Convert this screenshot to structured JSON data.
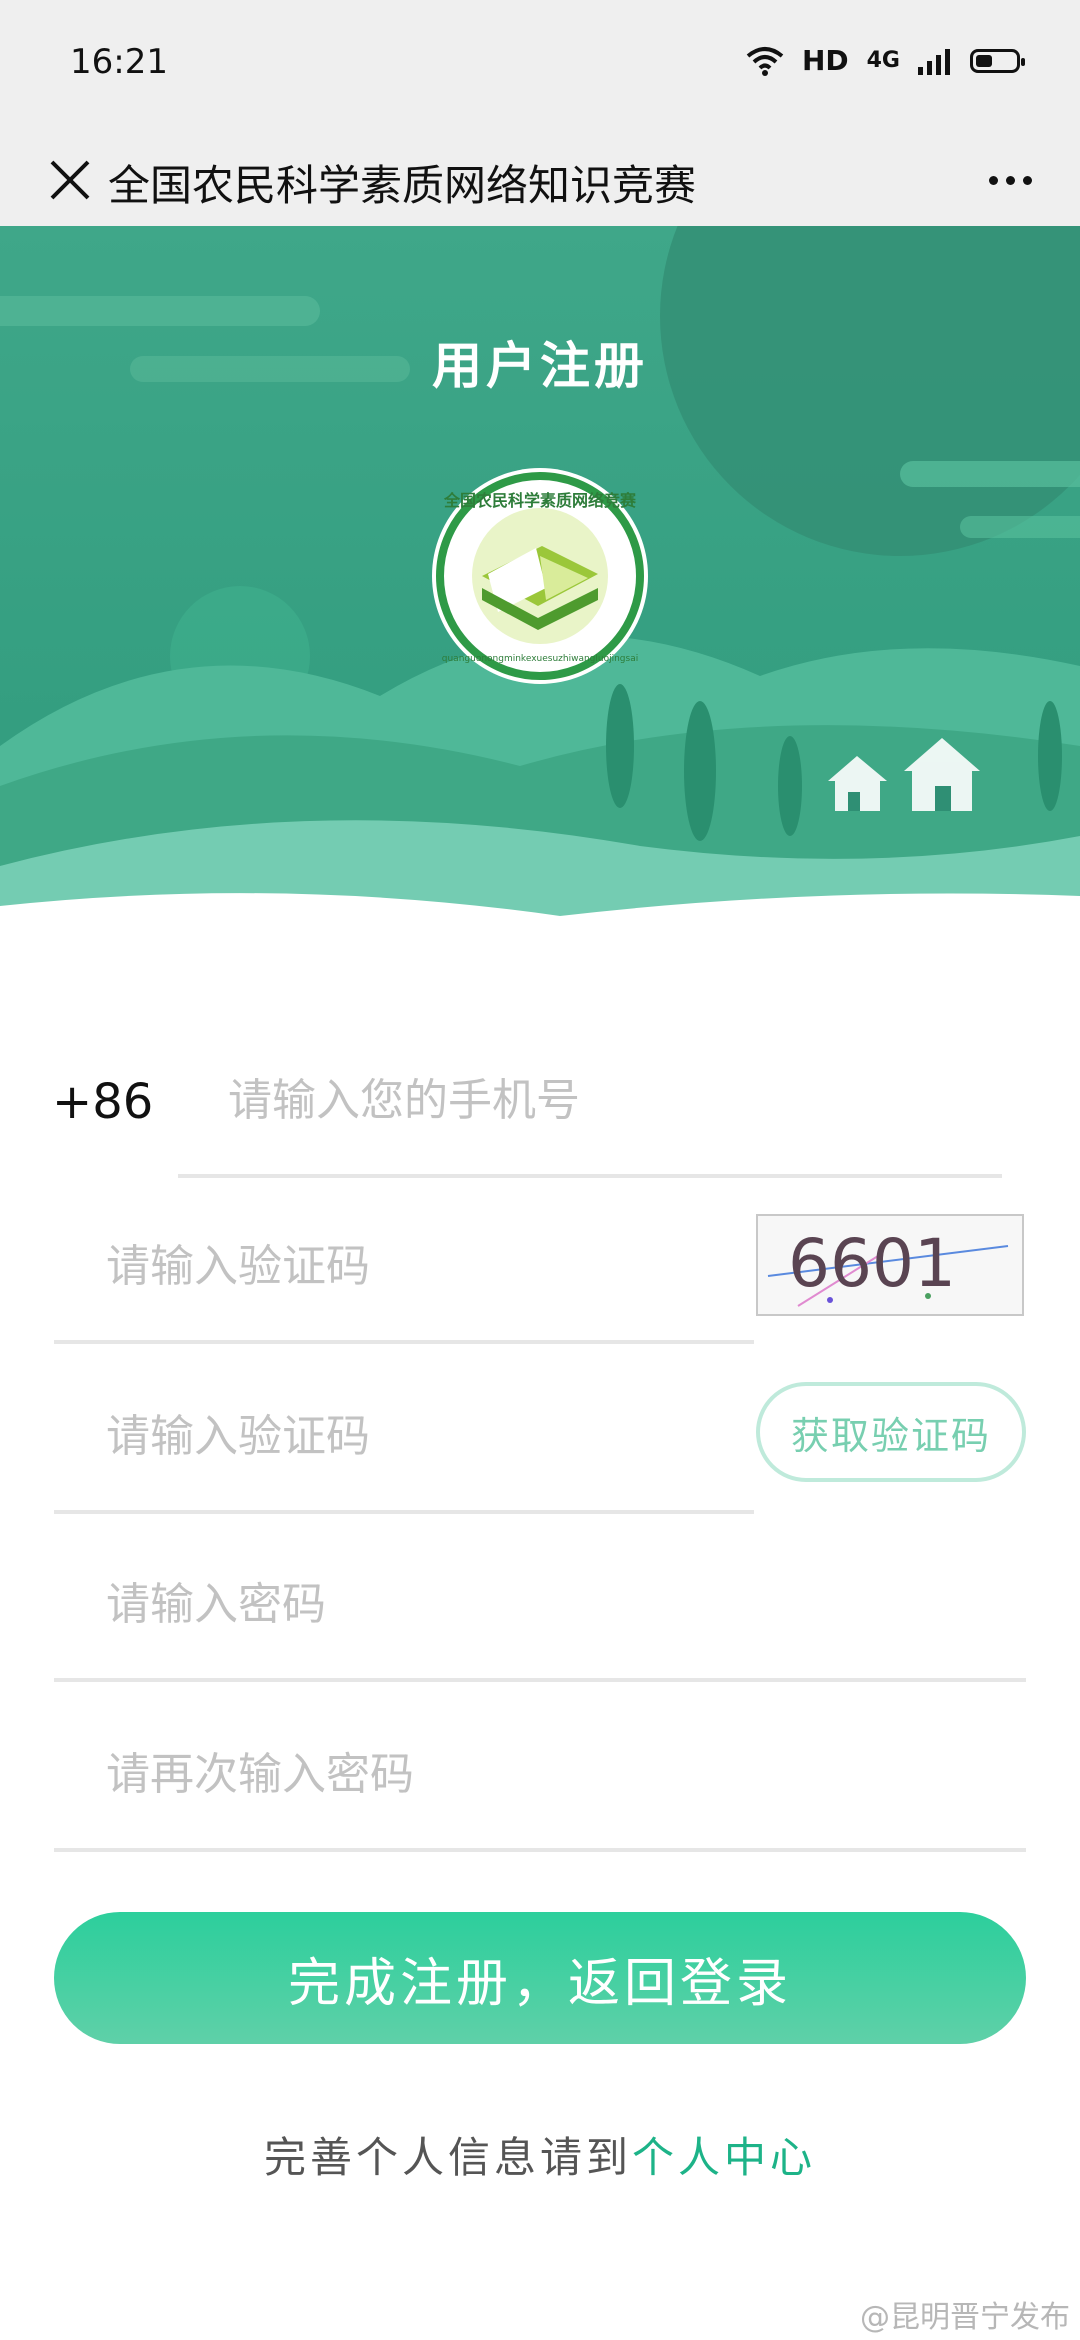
{
  "status_bar": {
    "time": "16:21",
    "hd": "HD",
    "network": "4G"
  },
  "nav": {
    "title": "全国农民科学素质网络知识竞赛",
    "close_icon": "close-icon",
    "more_icon": "more-icon"
  },
  "hero": {
    "title": "用户注册",
    "logo": {
      "ring_text": "全国农民科学素质网络竞赛",
      "pinyin": "quanguonongminkexuesuzhiwangluojingsai"
    }
  },
  "form": {
    "country_code": "+86",
    "phone_placeholder": "请输入您的手机号",
    "captcha_placeholder": "请输入验证码",
    "captcha_text": "6601",
    "sms_code_placeholder": "请输入验证码",
    "get_code_label": "获取验证码",
    "password_placeholder": "请输入密码",
    "confirm_password_placeholder": "请再次输入密码",
    "submit_label": "完成注册，返回登录",
    "footer_prefix": "完善个人信息请到",
    "footer_link": "个人中心"
  },
  "watermark": "@昆明晋宁发布",
  "colors": {
    "primary": "#2ccf9c",
    "hero_green": "#3aa487",
    "link": "#1db388"
  }
}
